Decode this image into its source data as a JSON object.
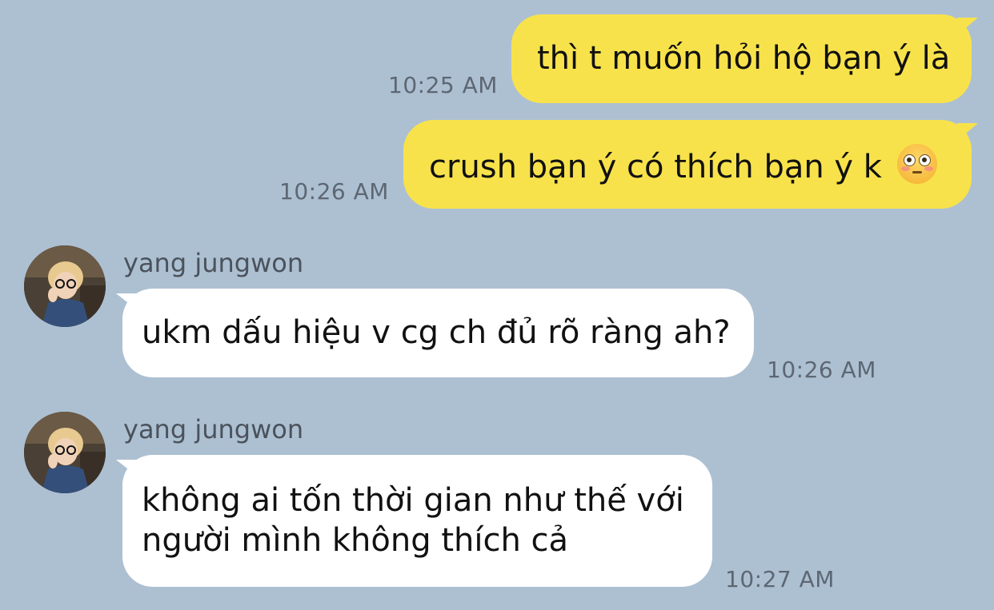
{
  "messages": [
    {
      "direction": "outgoing",
      "text": "thì t muốn hỏi hộ bạn ý là",
      "time": "10:25 AM"
    },
    {
      "direction": "outgoing",
      "text": "crush bạn ý có thích bạn ý k",
      "emoji": "flushed-face-emoji",
      "time": "10:26 AM"
    },
    {
      "direction": "incoming",
      "sender": "yang jungwon",
      "text": "ukm dấu hiệu v cg ch đủ rõ ràng ah?",
      "time": "10:26 AM"
    },
    {
      "direction": "incoming",
      "sender": "yang jungwon",
      "lines": [
        "không ai tốn thời gian như thế với",
        "người mình không thích cả"
      ],
      "time": "10:27 AM"
    }
  ],
  "colors": {
    "background": "#adc0d2",
    "outgoing_bubble": "#f8e24b",
    "incoming_bubble": "#ffffff",
    "timestamp": "#5d6773",
    "sender_name": "#4a525c"
  }
}
